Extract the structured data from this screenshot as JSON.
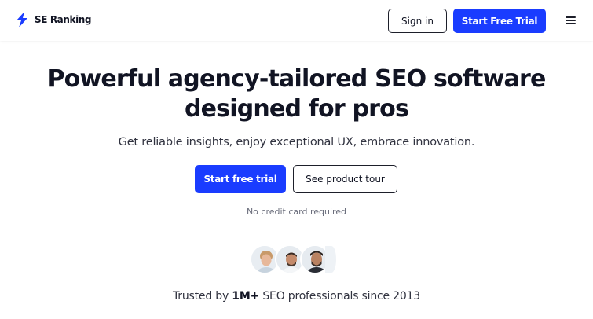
{
  "header": {
    "logo_text": "SE Ranking",
    "sign_in_label": "Sign in",
    "start_trial_label": "Start Free Trial",
    "brand_color": "#1a3cff"
  },
  "hero": {
    "headline_line1": "Powerful agency-tailored SEO software",
    "headline_line2": "designed for pros",
    "subtitle": "Get reliable insights, enjoy exceptional UX, embrace innovation.",
    "cta_primary": "Start free trial",
    "cta_secondary": "See product tour",
    "note": "No credit card required"
  },
  "trust": {
    "prefix": "Trusted by ",
    "highlight": "1M+",
    "suffix": " SEO professionals since 2013"
  }
}
